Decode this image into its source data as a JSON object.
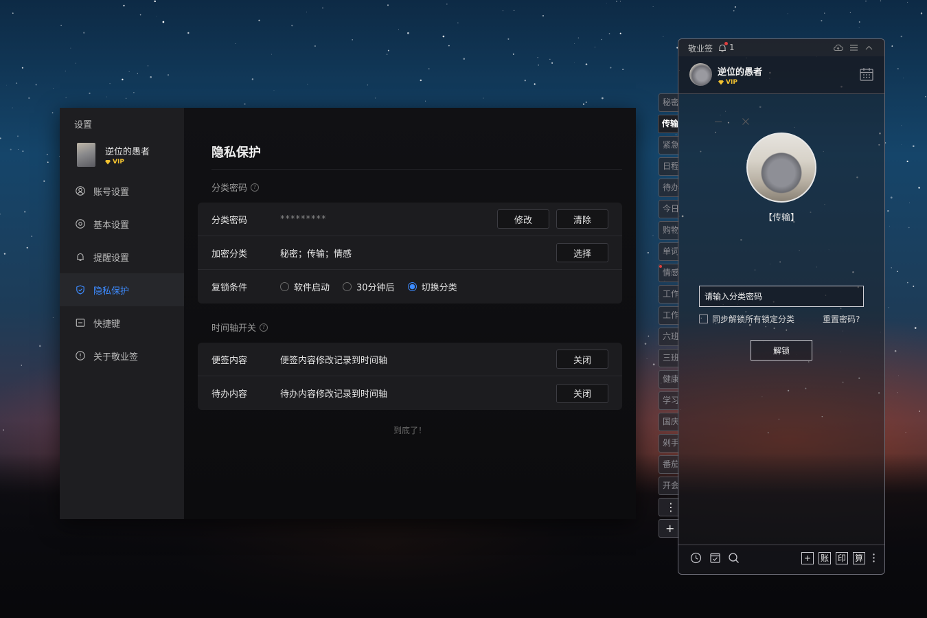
{
  "settings": {
    "window_title": "设置",
    "user": {
      "name": "逆位的愚者",
      "vip": "VIP"
    },
    "nav": [
      {
        "label": "账号设置"
      },
      {
        "label": "基本设置"
      },
      {
        "label": "提醒设置"
      },
      {
        "label": "隐私保护",
        "active": true
      },
      {
        "label": "快捷键"
      },
      {
        "label": "关于敬业签"
      }
    ],
    "page_title": "隐私保护",
    "section_password": {
      "title": "分类密码",
      "rows": {
        "password": {
          "label": "分类密码",
          "value": "*********",
          "modify": "修改",
          "clear": "清除"
        },
        "encrypted": {
          "label": "加密分类",
          "value": "秘密；传输；情感",
          "choose": "选择"
        },
        "relock": {
          "label": "复锁条件",
          "options": [
            {
              "label": "软件启动",
              "checked": false
            },
            {
              "label": "30分钟后",
              "checked": false
            },
            {
              "label": "切换分类",
              "checked": true
            }
          ]
        }
      }
    },
    "section_timeline": {
      "title": "时间轴开关",
      "rows": [
        {
          "label": "便签内容",
          "value": "便签内容修改记录到时间轴",
          "button": "关闭"
        },
        {
          "label": "待办内容",
          "value": "待办内容修改记录到时间轴",
          "button": "关闭"
        }
      ]
    },
    "footer": "到底了！"
  },
  "side_tabs": [
    "秘密",
    "传输",
    "紧急",
    "日程",
    "待办",
    "今日",
    "购物",
    "单词",
    "情感",
    "工作",
    "工作",
    "六班",
    "三班",
    "健康",
    "学习",
    "国庆",
    "剁手",
    "番茄",
    "开会"
  ],
  "side_tab_more": "⋮",
  "side_tab_add": "+",
  "widget": {
    "app_name": "敬业签",
    "notification_count": "1",
    "user": {
      "name": "逆位的愚者",
      "vip": "VIP"
    },
    "locked_category": "【传输】",
    "password_placeholder": "请输入分类密码",
    "sync_unlock_label": "同步解锁所有锁定分类",
    "reset_password": "重置密码?",
    "unlock_button": "解锁",
    "bottom_tools": [
      "账",
      "印",
      "算"
    ],
    "bottom_add": "+"
  },
  "colors": {
    "accent": "#3d8bff",
    "vip": "#f2c230",
    "alert": "#e04040"
  }
}
